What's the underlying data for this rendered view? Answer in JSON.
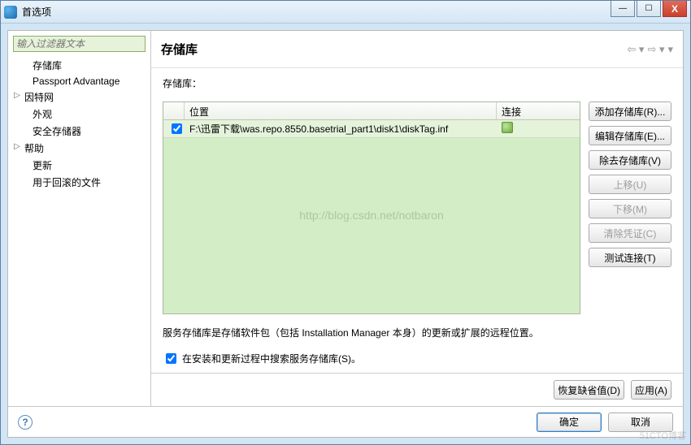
{
  "window": {
    "title": "首选项"
  },
  "winbtns": {
    "min": "—",
    "max": "☐",
    "close": "X"
  },
  "sidebar": {
    "filter_placeholder": "输入过滤器文本",
    "items": [
      {
        "label": "存储库",
        "level": 2
      },
      {
        "label": "Passport Advantage",
        "level": 2
      },
      {
        "label": "因特网",
        "level": 1,
        "expandable": true
      },
      {
        "label": "外观",
        "level": 2
      },
      {
        "label": "安全存储器",
        "level": 2
      },
      {
        "label": "帮助",
        "level": 1,
        "expandable": true
      },
      {
        "label": "更新",
        "level": 2
      },
      {
        "label": "用于回滚的文件",
        "level": 2
      }
    ]
  },
  "main": {
    "title": "存储库",
    "list_label": "存储库：",
    "columns": {
      "location": "位置",
      "connection": "连接"
    },
    "rows": [
      {
        "checked": true,
        "location": "F:\\迅雷下载\\was.repo.8550.basetrial_part1\\disk1\\diskTag.inf"
      }
    ],
    "watermark": "http://blog.csdn.net/notbaron",
    "buttons": {
      "add": "添加存储库(R)...",
      "edit": "编辑存储库(E)...",
      "remove": "除去存储库(V)",
      "up": "上移(U)",
      "down": "下移(M)",
      "clearcred": "清除凭证(C)",
      "test": "测试连接(T)"
    },
    "description": "服务存储库是存储软件包（包括 Installation Manager 本身）的更新或扩展的远程位置。",
    "service_search_label": "在安装和更新过程中搜索服务存储库(S)。",
    "service_search_checked": true,
    "restore_defaults": "恢复缺省值(D)",
    "apply": "应用(A)"
  },
  "footer": {
    "ok": "确定",
    "cancel": "取消"
  },
  "corner_wm": "51CTO博客"
}
